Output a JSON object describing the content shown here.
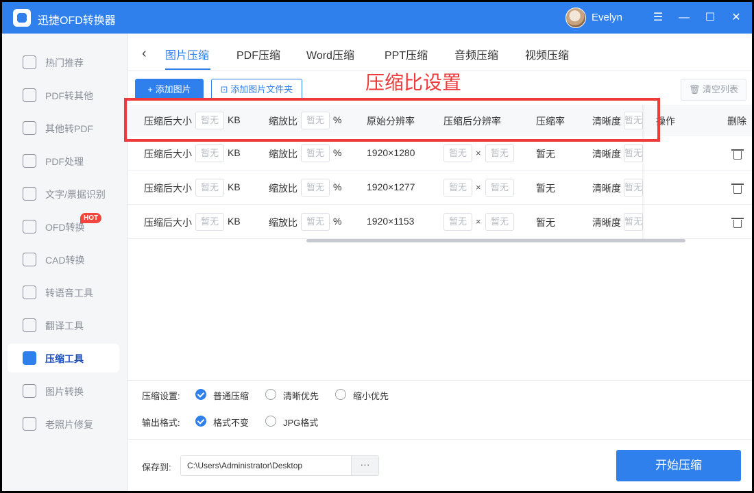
{
  "app": {
    "title": "迅捷OFD转换器",
    "user_name": "Evelyn",
    "accent": "#2f80ed",
    "annotation_color": "#ee3a3a"
  },
  "window_controls": {
    "menu": "☰",
    "minimize": "—",
    "maximize": "☐",
    "close": "✕"
  },
  "sidebar": {
    "items": [
      {
        "label": "热门推荐",
        "icon": "flame-icon"
      },
      {
        "label": "PDF转其他",
        "icon": "pdf-export-icon"
      },
      {
        "label": "其他转PDF",
        "icon": "pdf-import-icon"
      },
      {
        "label": "PDF处理",
        "icon": "pdf-edit-icon"
      },
      {
        "label": "文字/票据识别",
        "icon": "ocr-icon"
      },
      {
        "label": "OFD转换",
        "icon": "ofd-icon",
        "badge": "HOT"
      },
      {
        "label": "CAD转换",
        "icon": "cad-icon"
      },
      {
        "label": "转语音工具",
        "icon": "speech-icon"
      },
      {
        "label": "翻译工具",
        "icon": "translate-icon"
      },
      {
        "label": "压缩工具",
        "icon": "compress-icon",
        "active": true
      },
      {
        "label": "图片转换",
        "icon": "image-convert-icon"
      },
      {
        "label": "老照片修复",
        "icon": "photo-restore-icon"
      }
    ]
  },
  "tabs": [
    "图片压缩",
    "PDF压缩",
    "Word压缩",
    "PPT压缩",
    "音频压缩",
    "视频压缩"
  ],
  "toolbar": {
    "add_image": "+ 添加图片",
    "add_folder": "添加图片文件夹",
    "clear_list": "清空列表"
  },
  "annotation": {
    "title": "压缩比设置"
  },
  "table": {
    "header": {
      "size_label": "压缩后大小",
      "size_placeholder": "暂无",
      "size_unit": "KB",
      "scale_label": "缩放比",
      "scale_placeholder": "暂无",
      "scale_unit": "%",
      "orig_res": "原始分辨率",
      "new_res": "压缩后分辨率",
      "ratio": "压缩率",
      "clarity_label": "清晰度",
      "clarity_placeholder": "暂无",
      "action": "操作",
      "delete": "删除"
    },
    "rows": [
      {
        "size_label": "压缩后大小",
        "size_placeholder": "暂无",
        "size_unit": "KB",
        "scale_label": "缩放比",
        "scale_placeholder": "暂无",
        "scale_unit": "%",
        "orig_res": "1920×1280",
        "w_placeholder": "暂无",
        "times": "×",
        "h_placeholder": "暂无",
        "ratio": "暂无",
        "clarity_label": "清晰度",
        "clarity_placeholder": "暂无"
      },
      {
        "size_label": "压缩后大小",
        "size_placeholder": "暂无",
        "size_unit": "KB",
        "scale_label": "缩放比",
        "scale_placeholder": "暂无",
        "scale_unit": "%",
        "orig_res": "1920×1277",
        "w_placeholder": "暂无",
        "times": "×",
        "h_placeholder": "暂无",
        "ratio": "暂无",
        "clarity_label": "清晰度",
        "clarity_placeholder": "暂无"
      },
      {
        "size_label": "压缩后大小",
        "size_placeholder": "暂无",
        "size_unit": "KB",
        "scale_label": "缩放比",
        "scale_placeholder": "暂无",
        "scale_unit": "%",
        "orig_res": "1920×1153",
        "w_placeholder": "暂无",
        "times": "×",
        "h_placeholder": "暂无",
        "ratio": "暂无",
        "clarity_label": "清晰度",
        "clarity_placeholder": "暂无"
      }
    ]
  },
  "settings": {
    "compress_label": "压缩设置:",
    "compress_options": [
      "普通压缩",
      "清晰优先",
      "缩小优先"
    ],
    "compress_selected": 0,
    "format_label": "输出格式:",
    "format_options": [
      "格式不变",
      "JPG格式"
    ],
    "format_selected": 0
  },
  "output": {
    "save_label": "保存到:",
    "path": "C:\\Users\\Administrator\\Desktop",
    "browse": "···"
  },
  "start_button": "开始压缩"
}
